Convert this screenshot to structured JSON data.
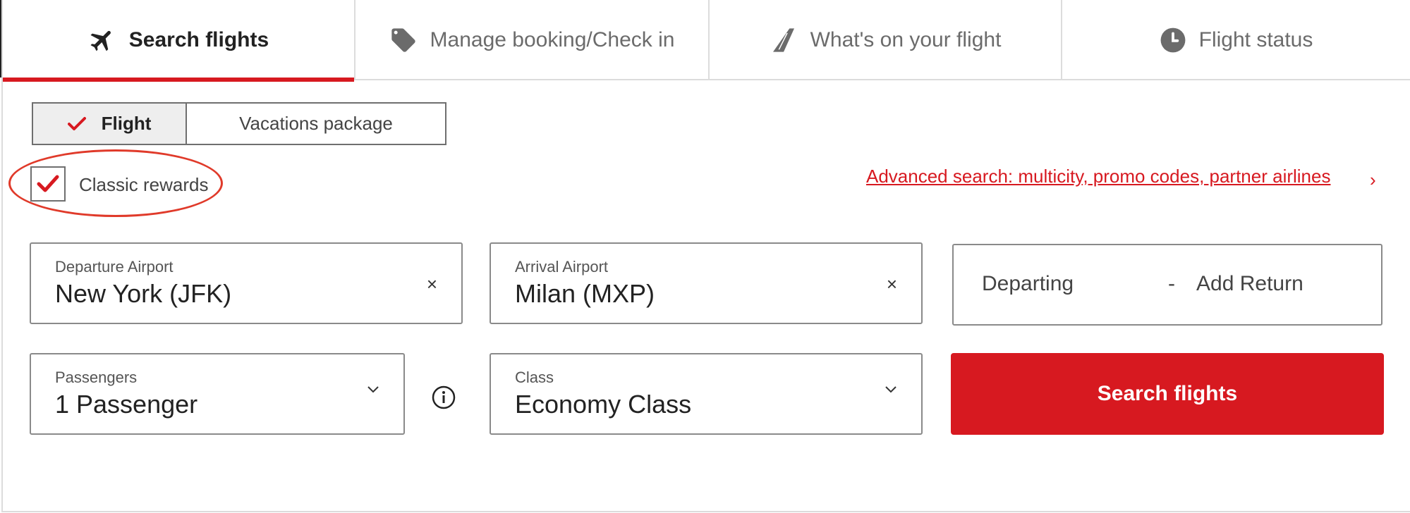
{
  "tabs": [
    {
      "label": "Search flights",
      "icon": "airplane-icon",
      "active": true
    },
    {
      "label": "Manage booking/Check in",
      "icon": "tag-icon",
      "active": false
    },
    {
      "label": "What's on your flight",
      "icon": "seat-icon",
      "active": false
    },
    {
      "label": "Flight status",
      "icon": "clock-icon",
      "active": false
    }
  ],
  "trip_type": {
    "selected": "Flight",
    "other": "Vacations package"
  },
  "rewards": {
    "label": "Classic rewards",
    "checked": true
  },
  "advanced_search": {
    "label": "Advanced search: multicity, promo codes, partner airlines",
    "chevron": "›"
  },
  "departure": {
    "label": "Departure Airport",
    "value": "New York (JFK)",
    "clear": "×"
  },
  "arrival": {
    "label": "Arrival Airport",
    "value": "Milan (MXP)",
    "clear": "×"
  },
  "dates": {
    "departing": "Departing",
    "separator": "-",
    "return": "Add Return"
  },
  "passengers": {
    "label": "Passengers",
    "value": "1 Passenger"
  },
  "cabin": {
    "label": "Class",
    "value": "Economy Class"
  },
  "search_button": {
    "label": "Search flights"
  },
  "colors": {
    "accent": "#d71920",
    "annotation": "#e03a2a",
    "border": "#8a8a8a"
  }
}
